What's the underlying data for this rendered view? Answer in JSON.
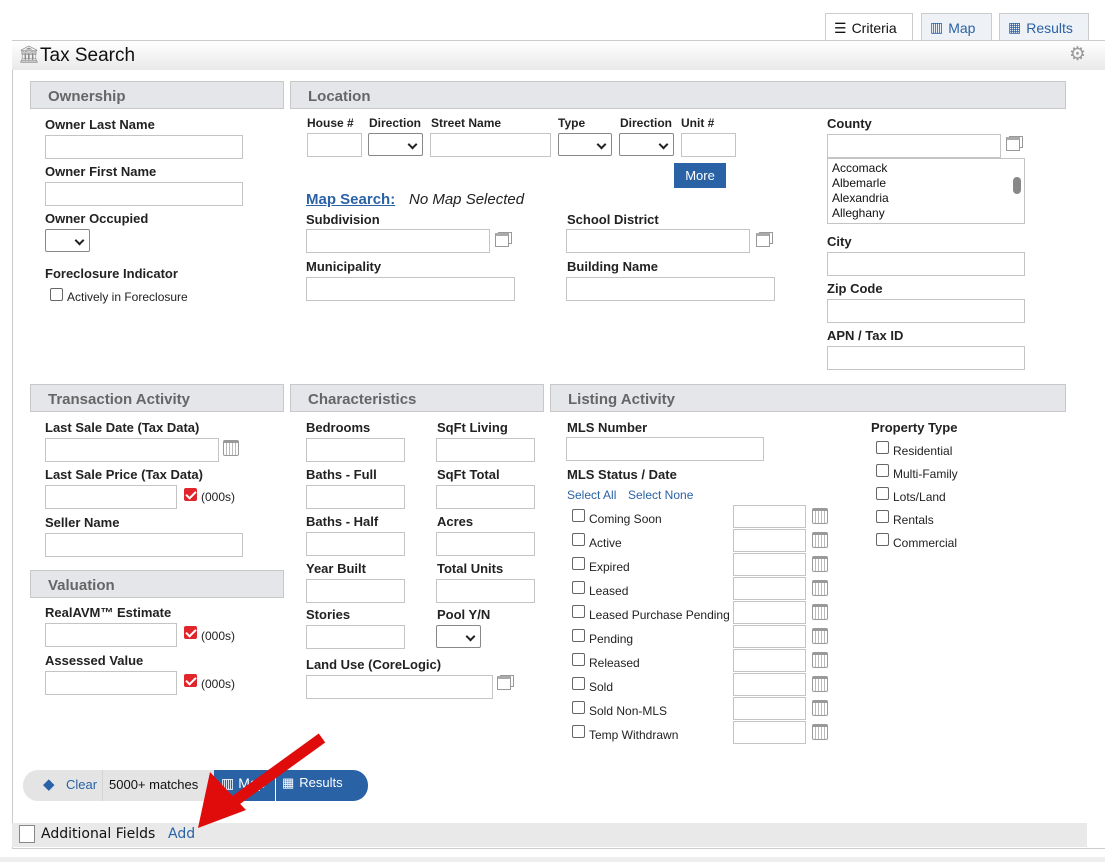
{
  "tabs": {
    "criteria": "Criteria",
    "map": "Map",
    "results": "Results"
  },
  "header": {
    "title": "Tax Search"
  },
  "ownership": {
    "title": "Ownership",
    "owner_last": "Owner Last Name",
    "owner_first": "Owner First Name",
    "owner_occupied": "Owner Occupied",
    "foreclosure": "Foreclosure Indicator",
    "actively": "Actively in Foreclosure"
  },
  "location": {
    "title": "Location",
    "house": "House #",
    "direction": "Direction",
    "street": "Street Name",
    "type": "Type",
    "direction2": "Direction",
    "unit": "Unit #",
    "more": "More",
    "map_search": "Map Search:",
    "no_map": "No Map Selected",
    "subdivision": "Subdivision",
    "school": "School District",
    "municipality": "Municipality",
    "building": "Building Name",
    "county": "County",
    "counties": [
      "Accomack",
      "Albemarle",
      "Alexandria",
      "Alleghany"
    ],
    "city": "City",
    "zip": "Zip Code",
    "apn": "APN / Tax ID"
  },
  "transaction": {
    "title": "Transaction Activity",
    "sale_date": "Last Sale Date (Tax Data)",
    "sale_price": "Last Sale Price (Tax Data)",
    "unit": "(000s)",
    "seller": "Seller Name"
  },
  "valuation": {
    "title": "Valuation",
    "avm": "RealAVM™ Estimate",
    "assessed": "Assessed Value",
    "unit": "(000s)"
  },
  "characteristics": {
    "title": "Characteristics",
    "bedrooms": "Bedrooms",
    "sqft_living": "SqFt Living",
    "baths_full": "Baths - Full",
    "sqft_total": "SqFt Total",
    "baths_half": "Baths - Half",
    "acres": "Acres",
    "year_built": "Year Built",
    "total_units": "Total Units",
    "stories": "Stories",
    "pool": "Pool Y/N",
    "land_use": "Land Use (CoreLogic)"
  },
  "listing": {
    "title": "Listing Activity",
    "mls_number": "MLS Number",
    "mls_status": "MLS Status / Date",
    "select_all": "Select All",
    "select_none": "Select None",
    "statuses": [
      "Coming Soon",
      "Active",
      "Expired",
      "Leased",
      "Leased Purchase Pending",
      "Pending",
      "Released",
      "Sold",
      "Sold Non-MLS",
      "Temp Withdrawn"
    ],
    "property_type": "Property Type",
    "property_types": [
      "Residential",
      "Multi-Family",
      "Lots/Land",
      "Rentals",
      "Commercial"
    ]
  },
  "footer": {
    "clear": "Clear",
    "matches": "5000+ matches",
    "map": "Map",
    "results": "Results",
    "additional": "Additional Fields",
    "add": "Add"
  },
  "colors": {
    "accent": "#2a62a6",
    "arrow": "#e00b0b"
  }
}
